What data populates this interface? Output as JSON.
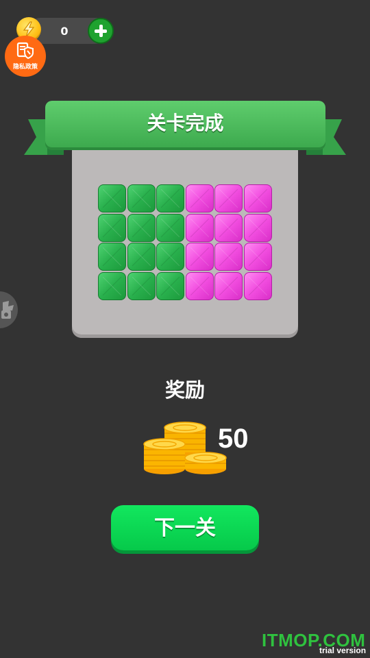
{
  "currency": {
    "amount": "0",
    "coin_icon": "lightning-coin-icon",
    "add_icon": "plus-icon"
  },
  "privacy": {
    "label": "隐私政策",
    "icon": "document-shield-icon"
  },
  "side_button": {
    "icon": "side-tool-icon"
  },
  "banner": {
    "title": "关卡完成"
  },
  "board": {
    "rows": [
      [
        "green",
        "green",
        "green",
        "pink",
        "pink",
        "pink"
      ],
      [
        "green",
        "green",
        "green",
        "pink",
        "pink",
        "pink"
      ],
      [
        "green",
        "green",
        "green",
        "pink",
        "pink",
        "pink"
      ],
      [
        "green",
        "green",
        "green",
        "pink",
        "pink",
        "pink"
      ]
    ],
    "colors": {
      "green": "#29b04d",
      "pink": "#f24ee0"
    }
  },
  "reward": {
    "title": "奖励",
    "amount": "50",
    "icon": "coin-stack-icon"
  },
  "next_button": {
    "label": "下一关"
  },
  "watermark": {
    "brand": "ITMOP.COM",
    "trial": "trial version"
  }
}
